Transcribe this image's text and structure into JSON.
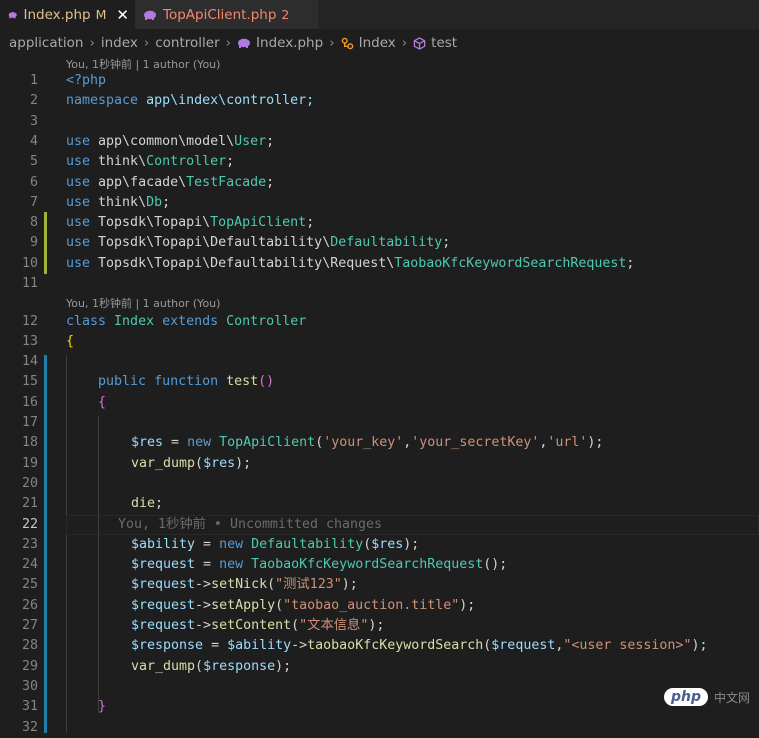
{
  "tabs": [
    {
      "label": "Index.php",
      "flag": "M",
      "close": "✕",
      "icon": "php-elephant-icon"
    },
    {
      "label": "TopApiClient.php",
      "flag": "2",
      "icon": "php-elephant-icon"
    }
  ],
  "breadcrumb": [
    "application",
    "index",
    "controller",
    "Index.php",
    "Index",
    "test"
  ],
  "lens": {
    "top": "You, 1秒钟前 | 1 author (You)",
    "class": "You, 1秒钟前 | 1 author (You)",
    "inline_blame": "You, 1秒钟前 • Uncommitted changes"
  },
  "line_numbers": [
    "1",
    "2",
    "3",
    "4",
    "5",
    "6",
    "7",
    "8",
    "9",
    "10",
    "11",
    "12",
    "13",
    "14",
    "15",
    "16",
    "17",
    "18",
    "19",
    "20",
    "21",
    "22",
    "23",
    "24",
    "25",
    "26",
    "27",
    "28",
    "29",
    "30",
    "31",
    "32"
  ],
  "code": {
    "l1": [
      "<?php"
    ],
    "l2": [
      "namespace",
      " app\\index\\controller;"
    ],
    "l4": [
      "use",
      " app\\common\\model\\",
      "User",
      ";"
    ],
    "l5": [
      "use",
      " think\\",
      "Controller",
      ";"
    ],
    "l6": [
      "use",
      " app\\facade\\",
      "TestFacade",
      ";"
    ],
    "l7": [
      "use",
      " think\\",
      "Db",
      ";"
    ],
    "l8": [
      "use",
      " Topsdk\\Topapi\\",
      "TopApiClient",
      ";"
    ],
    "l9": [
      "use",
      " Topsdk\\Topapi\\Defaultability\\",
      "Defaultability",
      ";"
    ],
    "l10": [
      "use",
      " Topsdk\\Topapi\\Defaultability\\Request\\",
      "TaobaoKfcKeywordSearchRequest",
      ";"
    ],
    "l12": [
      "class",
      " ",
      "Index",
      " ",
      "extends",
      " ",
      "Controller"
    ],
    "l13": [
      "{"
    ],
    "l15": [
      "public",
      " ",
      "function",
      " ",
      "test",
      "()"
    ],
    "l16": [
      "{"
    ],
    "l18": [
      "$res",
      " = ",
      "new",
      " ",
      "TopApiClient",
      "(",
      "'your_key'",
      ",",
      "'your_secretKey'",
      ",",
      "'url'",
      ");"
    ],
    "l19": [
      "var_dump",
      "(",
      "$res",
      ");"
    ],
    "l21": [
      "die",
      ";"
    ],
    "l23": [
      "$ability",
      " = ",
      "new",
      " ",
      "Defaultability",
      "(",
      "$res",
      ");"
    ],
    "l24": [
      "$request",
      " = ",
      "new",
      " ",
      "TaobaoKfcKeywordSearchRequest",
      "();"
    ],
    "l25": [
      "$request",
      "->",
      "setNick",
      "(",
      "\"测试123\"",
      ");"
    ],
    "l26": [
      "$request",
      "->",
      "setApply",
      "(",
      "\"taobao_auction.title\"",
      ");"
    ],
    "l27": [
      "$request",
      "->",
      "setContent",
      "(",
      "\"文本信息\"",
      ");"
    ],
    "l28": [
      "$response",
      " = ",
      "$ability",
      "->",
      "taobaoKfcKeywordSearch",
      "(",
      "$request",
      ",",
      "\"<user session>\"",
      ");"
    ],
    "l29": [
      "var_dump",
      "(",
      "$response",
      ");"
    ],
    "l31": [
      "}"
    ]
  },
  "watermark": {
    "pill": "php",
    "text": "中文网"
  },
  "colors": {
    "keyword": "#569cd6",
    "type": "#4ec9b0",
    "variable": "#9cdcfe",
    "function": "#dcdcaa",
    "string": "#ce9178",
    "modified_gutter": "#a0b23a",
    "added_gutter": "#1b81a8"
  }
}
